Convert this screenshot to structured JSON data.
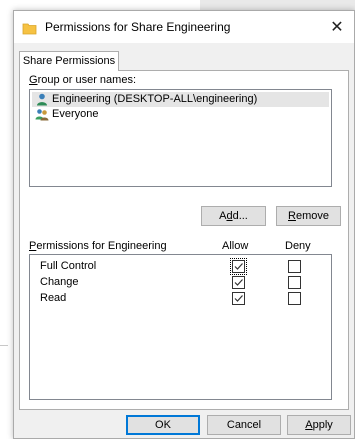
{
  "dialog": {
    "title": "Permissions for Share Engineering",
    "close_glyph": "✕",
    "title_icon": "folder-icon"
  },
  "tab": {
    "label": "Share Permissions"
  },
  "group_section": {
    "label": "Group or user names:",
    "entries": [
      {
        "name": "Engineering (DESKTOP-ALL\\engineering)",
        "icon": "single-user-icon",
        "selected": true
      },
      {
        "name": "Everyone",
        "icon": "user-group-icon",
        "selected": false
      }
    ],
    "add_button": "Add...",
    "remove_button": "Remove"
  },
  "permissions": {
    "header": "Permissions for Engineering",
    "allow_header": "Allow",
    "deny_header": "Deny",
    "rows": [
      {
        "name": "Full Control",
        "allow": true,
        "deny": false
      },
      {
        "name": "Change",
        "allow": true,
        "deny": false
      },
      {
        "name": "Read",
        "allow": true,
        "deny": false
      }
    ]
  },
  "footer": {
    "ok": "OK",
    "cancel": "Cancel",
    "apply": "Apply"
  },
  "colors": {
    "accent": "#0078d7",
    "selection": "#e5e5e5",
    "folder": "#f6c243"
  }
}
